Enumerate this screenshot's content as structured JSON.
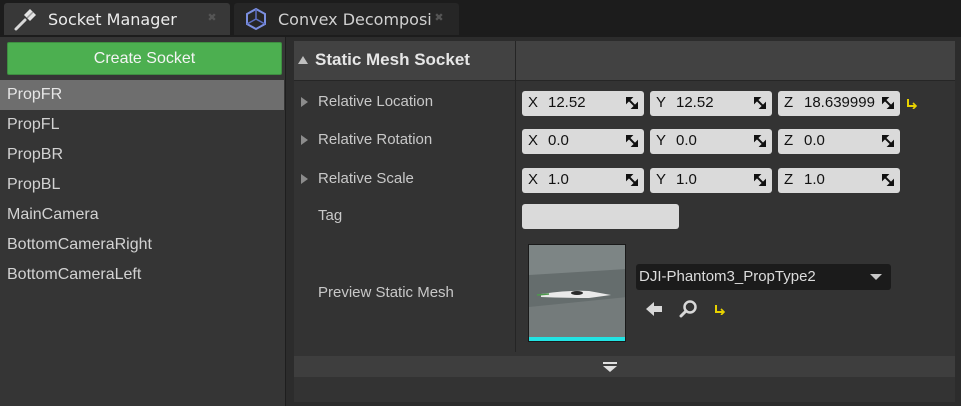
{
  "tabs": [
    {
      "label": "Socket Manager",
      "icon": "socket-manager-icon",
      "active": true
    },
    {
      "label": "Convex Decomposi",
      "icon": "convex-decomposition-icon",
      "active": false
    }
  ],
  "left_panel": {
    "create_button": "Create Socket",
    "sockets": [
      "PropFR",
      "PropFL",
      "PropBR",
      "PropBL",
      "MainCamera",
      "BottomCameraRight",
      "BottomCameraLeft"
    ],
    "selected": "PropFR"
  },
  "details": {
    "category": "Static Mesh Socket",
    "location": {
      "label": "Relative Location",
      "x": "12.52",
      "y": "12.52",
      "z": "18.639999"
    },
    "rotation": {
      "label": "Relative Rotation",
      "x": "0.0",
      "y": "0.0",
      "z": "0.0"
    },
    "scale": {
      "label": "Relative Scale",
      "x": "1.0",
      "y": "1.0",
      "z": "1.0"
    },
    "axis_labels": {
      "x": "X",
      "y": "Y",
      "z": "Z"
    },
    "tag": {
      "label": "Tag",
      "value": ""
    },
    "preview": {
      "label": "Preview Static Mesh",
      "asset": "DJI-Phantom3_PropType2"
    }
  },
  "colors": {
    "create_button": "#4caf50",
    "selection": "#6e6e6e",
    "thumbnail_bar": "#22e3e3",
    "reset_arrow": "#e8d200"
  }
}
